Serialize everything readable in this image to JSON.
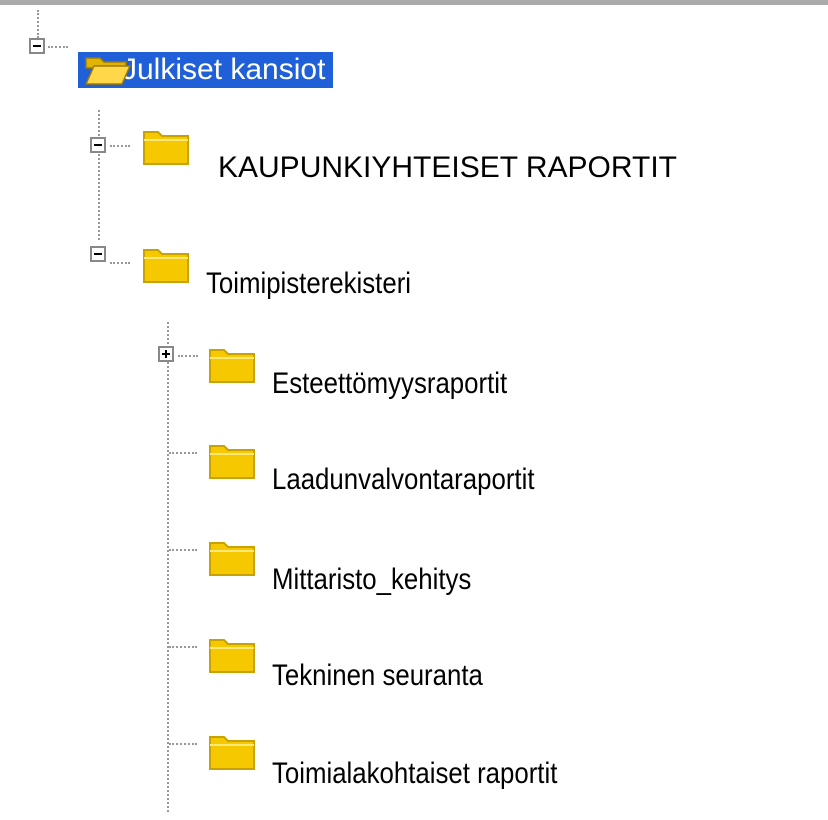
{
  "tree": {
    "root": {
      "label": "Julkiset kansiot",
      "expanded": true,
      "selected": true,
      "icon": "folder-open-icon"
    },
    "children": [
      {
        "label": "KAUPUNKIYHTEISET RAPORTIT",
        "expanded": true,
        "icon": "folder-icon"
      },
      {
        "label": "Toimipisterekisteri",
        "expanded": true,
        "icon": "folder-icon",
        "children": [
          {
            "label": "Esteettömyysraportit",
            "expanded": false,
            "icon": "folder-icon"
          },
          {
            "label": "Laadunvalvontaraportit",
            "icon": "folder-icon"
          },
          {
            "label": "Mittaristo_kehitys",
            "icon": "folder-icon"
          },
          {
            "label": "Tekninen seuranta",
            "icon": "folder-icon"
          },
          {
            "label": "Toimialakohtaiset raportit",
            "icon": "folder-icon"
          }
        ]
      }
    ]
  },
  "colors": {
    "selection": "#1f5fd8",
    "folder_fill": "#f5c800",
    "folder_edge": "#c8a200",
    "tree_lines": "#999999"
  }
}
